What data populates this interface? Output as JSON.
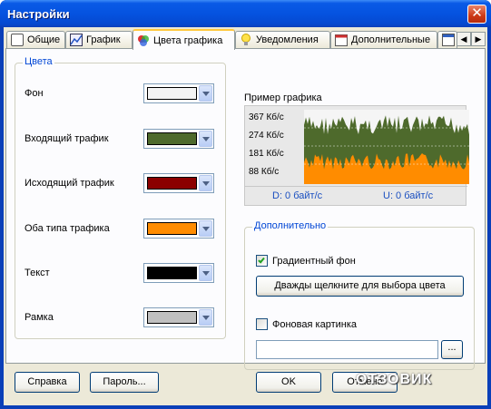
{
  "window": {
    "title": "Настройки"
  },
  "tabs": [
    {
      "label": "Общие",
      "icon": "general-icon"
    },
    {
      "label": "График",
      "icon": "chart-icon"
    },
    {
      "label": "Цвета графика",
      "icon": "palette-icon",
      "active": true
    },
    {
      "label": "Уведомления",
      "icon": "bulb-icon"
    },
    {
      "label": "Дополнительные",
      "icon": "calendar-icon"
    }
  ],
  "colors": {
    "title": "Цвета",
    "rows": [
      {
        "label": "Фон",
        "color": "#f4f4f4"
      },
      {
        "label": "Входящий трафик",
        "color": "#4e6a2c"
      },
      {
        "label": "Исходящий трафик",
        "color": "#8b0000"
      },
      {
        "label": "Оба типа трафика",
        "color": "#ff8c00"
      },
      {
        "label": "Текст",
        "color": "#000000"
      },
      {
        "label": "Рамка",
        "color": "#c0c0c0"
      }
    ]
  },
  "preview": {
    "title": "Пример графика",
    "ticks": [
      "367 Кб/с",
      "274 Кб/с",
      "181 Кб/с",
      "88 Кб/с"
    ],
    "download": "D: 0 байт/с",
    "upload": "U: 0 байт/с"
  },
  "extra": {
    "title": "Дополнительно",
    "gradient_label": "Градиентный фон",
    "gradient_checked": true,
    "pick_color_button": "Дважды щелкните для выбора цвета",
    "bg_image_label": "Фоновая картинка",
    "bg_image_checked": false,
    "bg_image_path": "",
    "browse_button": "..."
  },
  "buttons": {
    "help": "Справка",
    "password": "Пароль...",
    "ok": "OK",
    "cancel": "Отмена"
  },
  "watermark": "ОТЗОВИК"
}
